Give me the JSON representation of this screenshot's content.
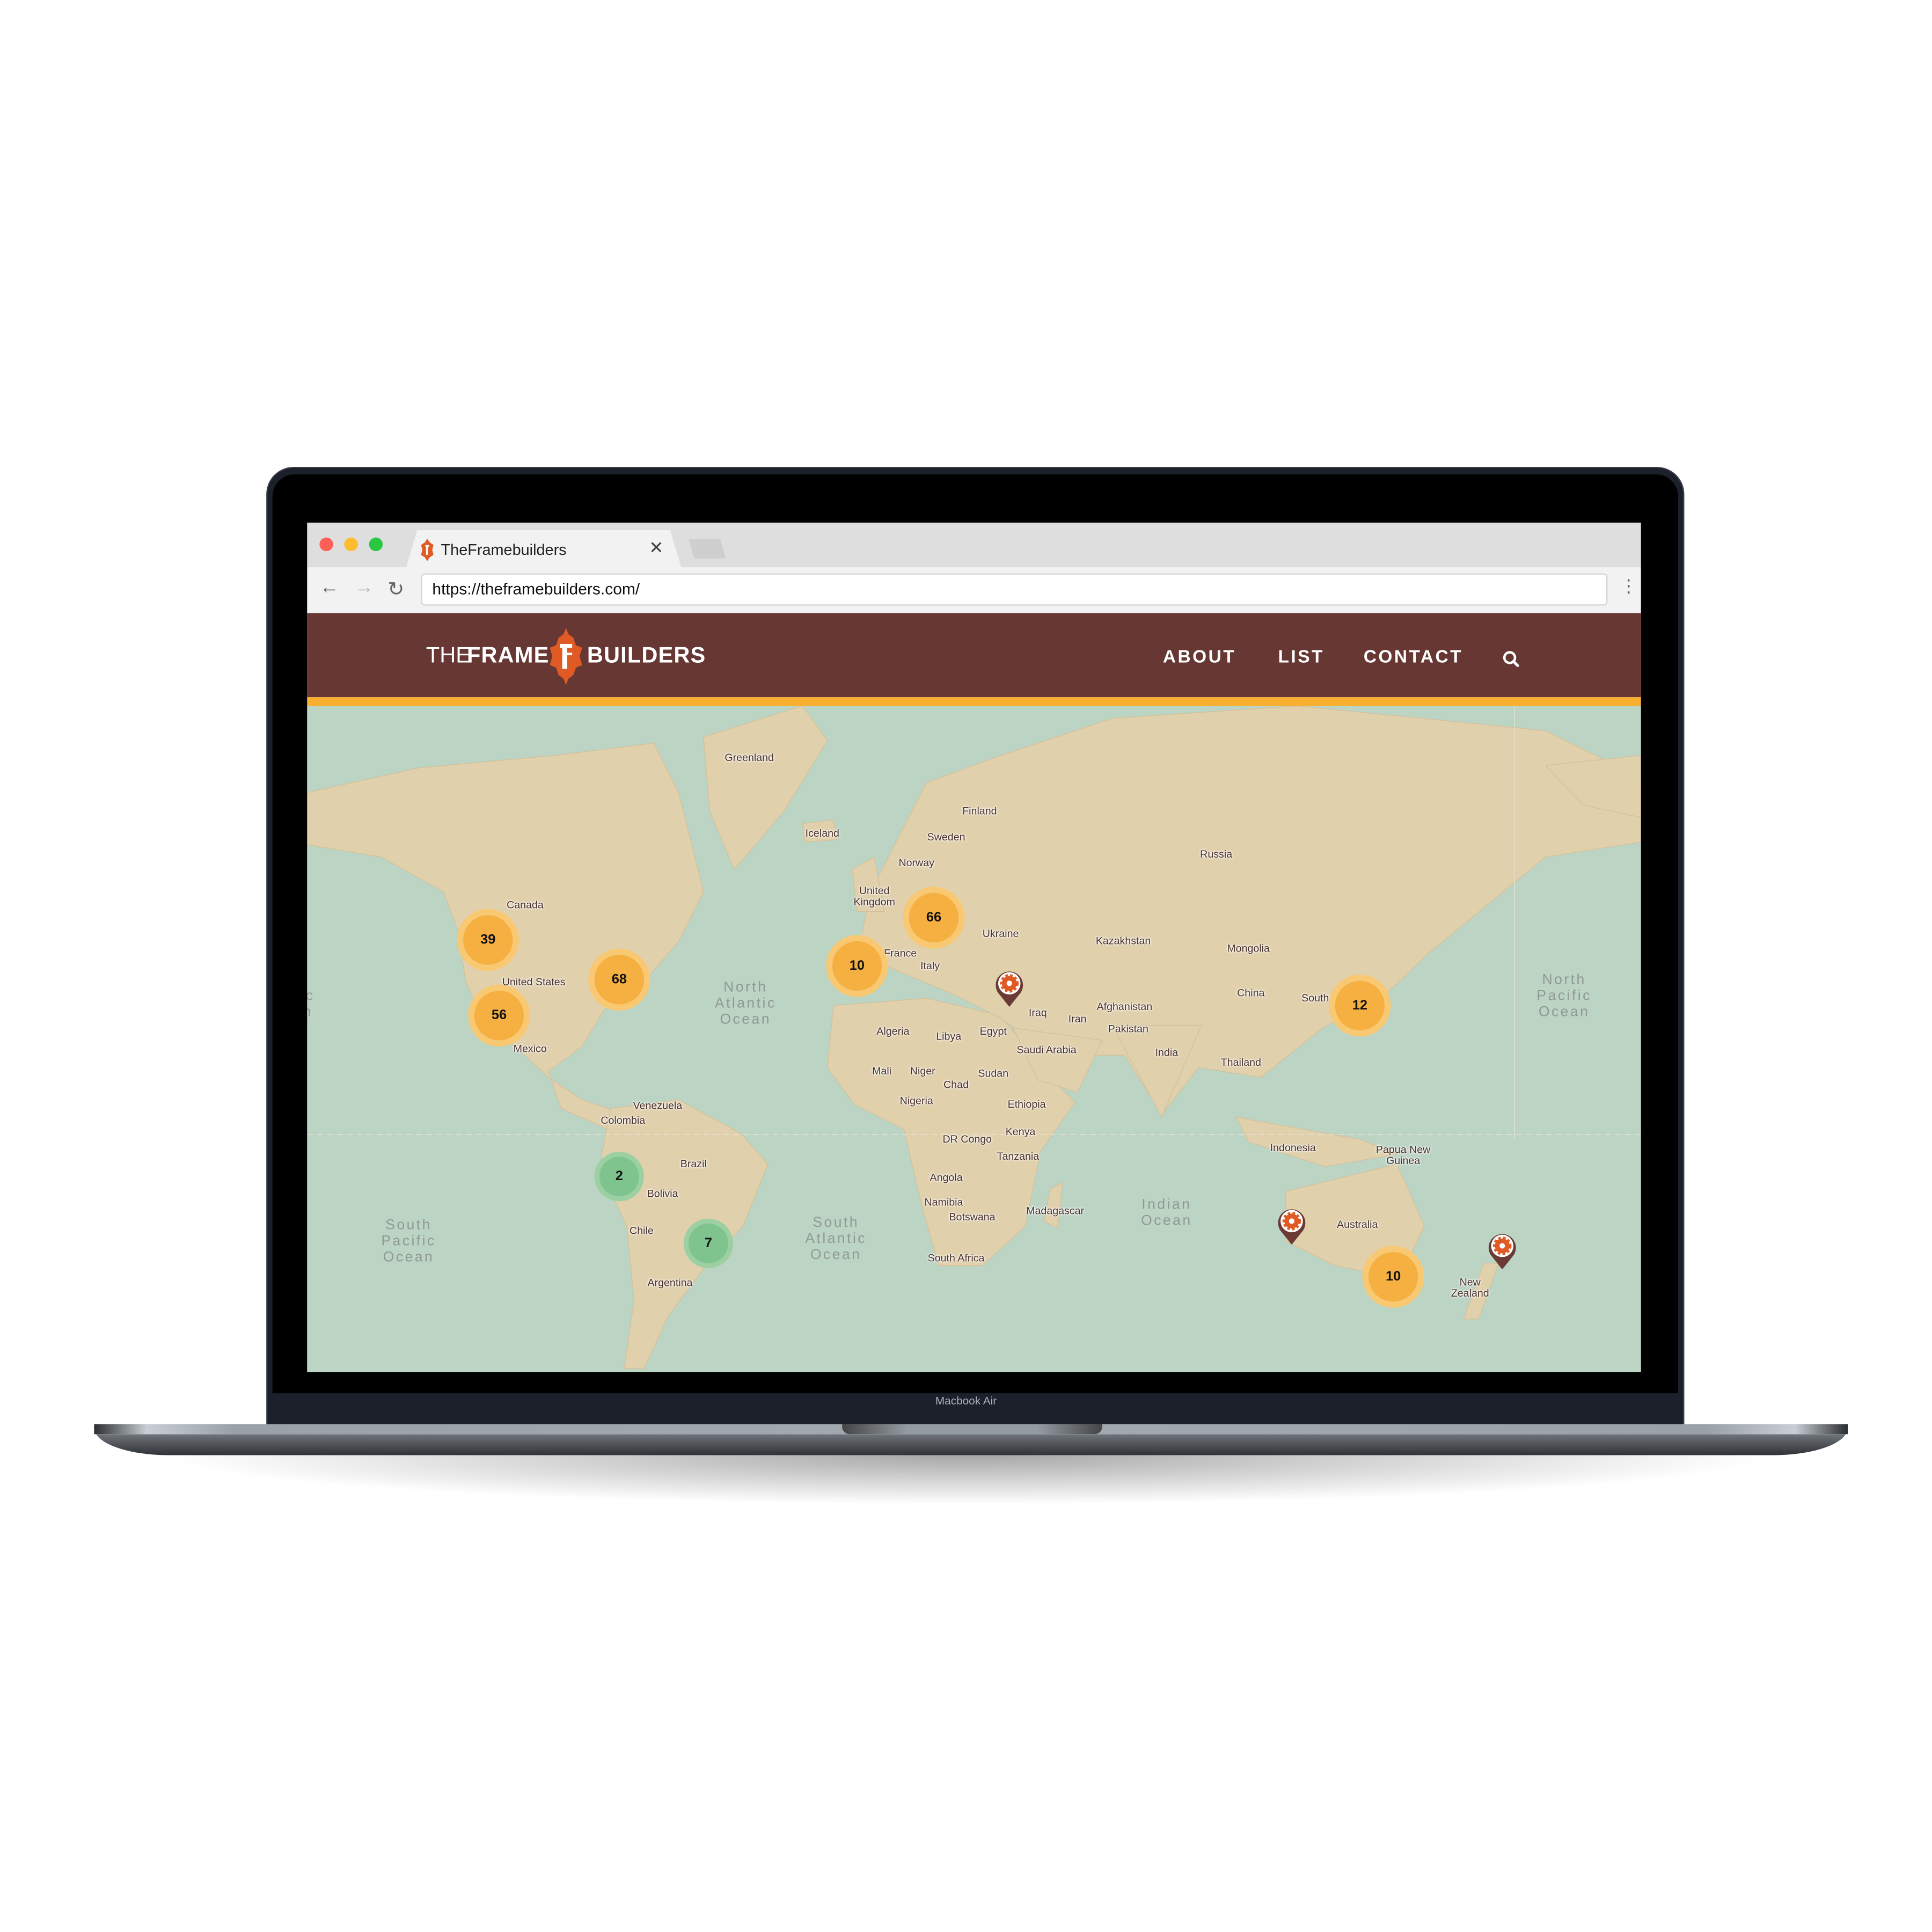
{
  "browser": {
    "tab_title": "TheFramebuilders",
    "tab_close_icon": "close-icon",
    "url": "https://theframebuilders.com/",
    "traffic_lights": {
      "close": "#fe5f57",
      "minimize": "#febc2e",
      "zoom": "#28c840"
    }
  },
  "site": {
    "logo": {
      "the": "THE",
      "frame": "FRAME",
      "builders": "BUILDERS"
    },
    "nav": [
      {
        "label": "ABOUT"
      },
      {
        "label": "LIST"
      },
      {
        "label": "CONTACT"
      }
    ],
    "search_icon": "search-icon",
    "colors": {
      "header": "#673733",
      "accent": "#f8ae2e",
      "logo": "#e05a25",
      "sea": "#bcd4c4",
      "land": "#e0d0ac",
      "cluster": "#f6af41",
      "cluster_small": "#7fc48f",
      "pin": "#6b3a34"
    }
  },
  "map": {
    "countries": [
      "Greenland",
      "Iceland",
      "Finland",
      "Sweden",
      "Norway",
      "United\nKingdom",
      "Russia",
      "Canada",
      "Ukraine",
      "Kazakhstan",
      "Mongolia",
      "United States",
      "Italy",
      "France",
      "China",
      "South",
      "Iraq",
      "Iran",
      "Afghanistan",
      "Pakistan",
      "Algeria",
      "Libya",
      "Egypt",
      "Saudi Arabia",
      "India",
      "Mexico",
      "Thailand",
      "Mali",
      "Niger",
      "Chad",
      "Sudan",
      "Nigeria",
      "Ethiopia",
      "Venezuela",
      "Colombia",
      "Kenya",
      "DR Congo",
      "Tanzania",
      "Indonesia",
      "Papua New\nGuinea",
      "Brazil",
      "Angola",
      "Bolivia",
      "Namibia",
      "Madagascar",
      "Botswana",
      "Australia",
      "Chile",
      "South Africa",
      "Argentina",
      "New\nZealand"
    ],
    "oceans": [
      "North\nAtlantic\nOcean",
      "North\nPacific\nOcean",
      "South\nPacific\nOcean",
      "South\nAtlantic\nOcean",
      "Indian\nOcean",
      "North\nPacific\nOcean"
    ],
    "clusters": [
      {
        "count": "39",
        "kind": "large"
      },
      {
        "count": "68",
        "kind": "large"
      },
      {
        "count": "56",
        "kind": "large"
      },
      {
        "count": "66",
        "kind": "large"
      },
      {
        "count": "10",
        "kind": "large"
      },
      {
        "count": "12",
        "kind": "large"
      },
      {
        "count": "10",
        "kind": "large"
      },
      {
        "count": "2",
        "kind": "small"
      },
      {
        "count": "7",
        "kind": "small"
      }
    ],
    "pins": [
      {
        "icon": "gear-pin-icon"
      },
      {
        "icon": "gear-pin-icon"
      },
      {
        "icon": "gear-pin-icon"
      }
    ]
  },
  "device": {
    "model_label": "Macbook Air"
  }
}
